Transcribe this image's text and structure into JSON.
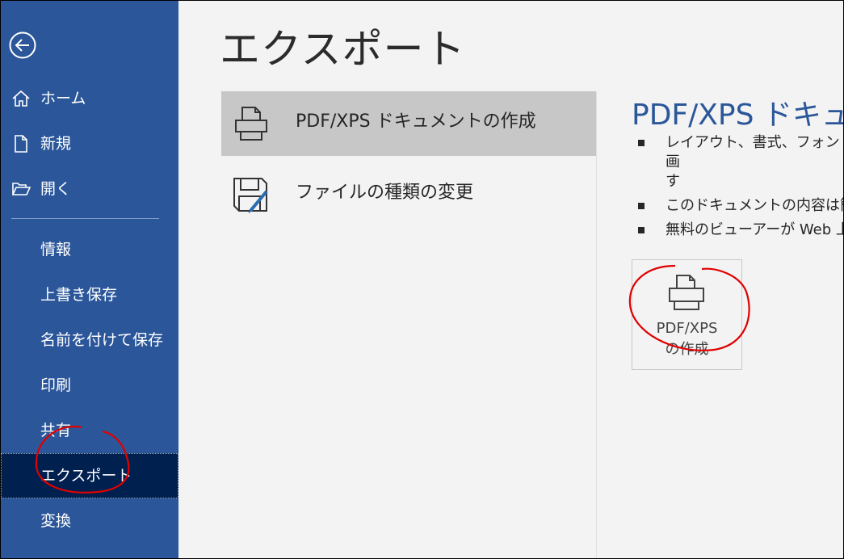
{
  "sidebar": {
    "back_icon": "back-arrow-icon",
    "items": [
      {
        "label": "ホーム",
        "icon": "home-icon"
      },
      {
        "label": "新規",
        "icon": "new-document-icon"
      },
      {
        "label": "開く",
        "icon": "open-folder-icon"
      },
      {
        "label": "情報"
      },
      {
        "label": "上書き保存"
      },
      {
        "label": "名前を付けて保存"
      },
      {
        "label": "印刷"
      },
      {
        "label": "共有"
      },
      {
        "label": "エクスポート",
        "selected": true
      },
      {
        "label": "変換"
      }
    ]
  },
  "main": {
    "title": "エクスポート",
    "options": [
      {
        "label": "PDF/XPS ドキュメントの作成",
        "icon": "pdf-printer-icon",
        "selected": true
      },
      {
        "label": "ファイルの種類の変更",
        "icon": "change-file-type-icon"
      }
    ],
    "detail": {
      "title": "PDF/XPS ドキュメ",
      "bullets": [
        "レイアウト、書式、フォント、画",
        "す",
        "このドキュメントの内容は簡単",
        "無料のビューアーが Web 上"
      ],
      "button_label_line1": "PDF/XPS",
      "button_label_line2": "の作成"
    }
  },
  "colors": {
    "sidebar_bg": "#2b579a",
    "sidebar_selected": "#002050",
    "accent": "#2b579a",
    "annotation": "#e00000"
  }
}
